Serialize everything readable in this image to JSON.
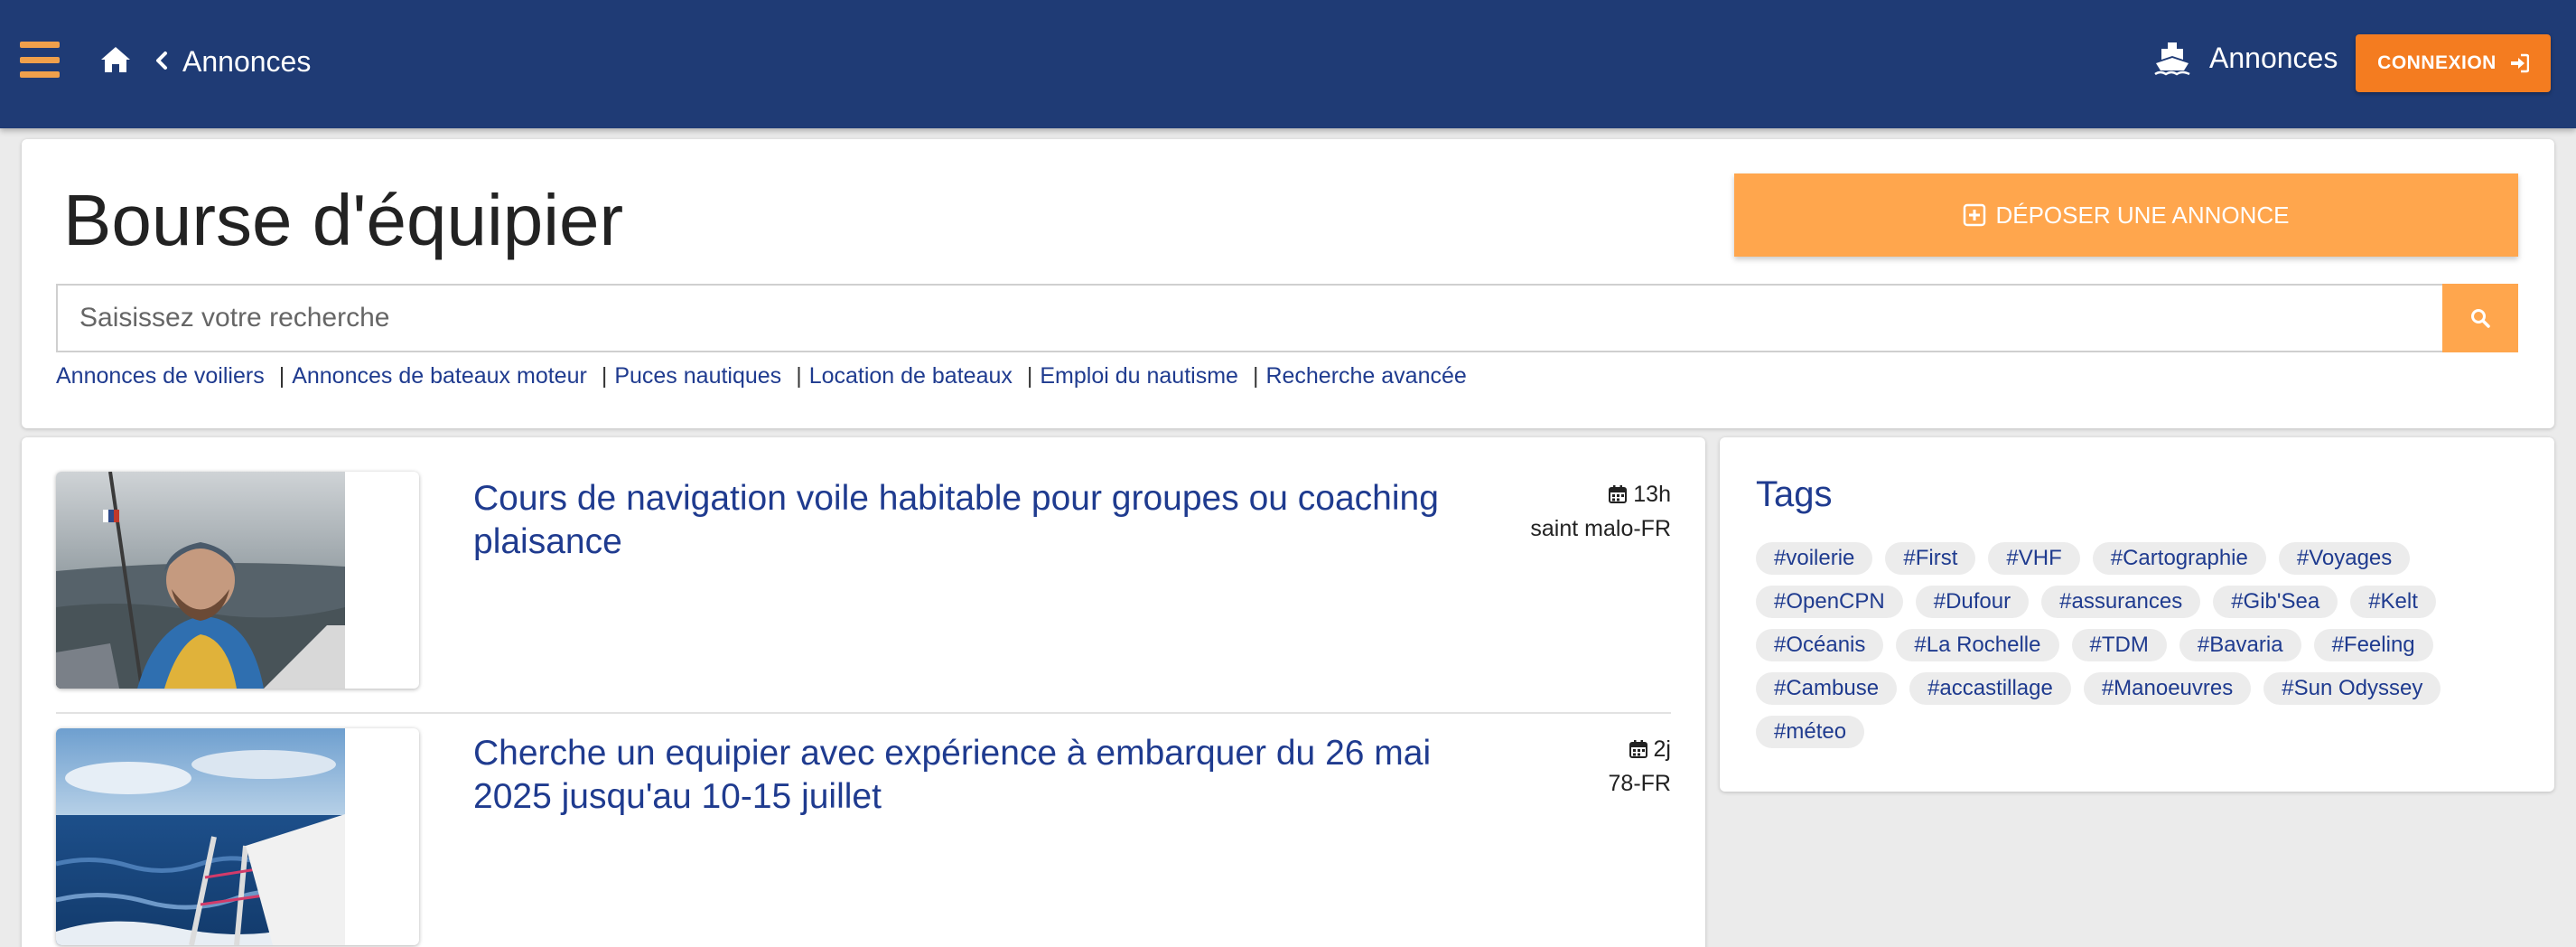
{
  "navbar": {
    "breadcrumb": "Annonces",
    "section_label": "Annonces",
    "login_label": "CONNEXION"
  },
  "header": {
    "title": "Bourse d'équipier",
    "post_button": "DÉPOSER UNE ANNONCE",
    "search_placeholder": "Saisissez votre recherche",
    "links": [
      "Annonces de voiliers",
      "Annonces de bateaux moteur",
      "Puces nautiques",
      "Location de bateaux",
      "Emploi du nautisme",
      "Recherche avancée"
    ]
  },
  "listings": [
    {
      "title": "Cours de navigation voile habitable pour groupes ou coaching plaisance",
      "age": "13h",
      "location": "saint malo-FR"
    },
    {
      "title": "Cherche un equipier avec expérience à embarquer du 26 mai 2025 jusqu'au 10-15 juillet",
      "age": "2j",
      "location": "78-FR"
    }
  ],
  "tags": {
    "title": "Tags",
    "items": [
      "#voilerie",
      "#First",
      "#VHF",
      "#Cartographie",
      "#Voyages",
      "#OpenCPN",
      "#Dufour",
      "#assurances",
      "#Gib'Sea",
      "#Kelt",
      "#Océanis",
      "#La Rochelle",
      "#TDM",
      "#Bavaria",
      "#Feeling",
      "#Cambuse",
      "#accastillage",
      "#Manoeuvres",
      "#Sun Odyssey",
      "#méteo"
    ]
  },
  "colors": {
    "navbar": "#1f3b75",
    "accent_orange": "#f47c20",
    "button_orange": "#ffa64d",
    "link_blue": "#1f3b8f",
    "hamburger": "#f0a04b"
  },
  "icons": [
    "menu-icon",
    "home-icon",
    "chevron-left-icon",
    "ship-icon",
    "sign-in-icon",
    "plus-square-icon",
    "search-icon",
    "calendar-icon"
  ]
}
